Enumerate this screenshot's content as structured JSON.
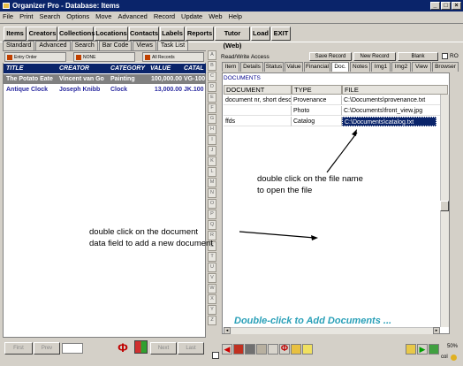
{
  "window": {
    "title": "Organizer Pro - Database: Items"
  },
  "menu": [
    "File",
    "Print",
    "Search",
    "Options",
    "Move",
    "Advanced",
    "Record",
    "Update",
    "Web",
    "Help"
  ],
  "toolbar": {
    "buttons": [
      "Items",
      "Creators",
      "Collections",
      "Locations",
      "Contacts",
      "Labels",
      "Reports",
      "Tutor (Web)",
      "Load",
      "EXIT"
    ]
  },
  "left_tabs": [
    "Standard",
    "Advanced",
    "Search",
    "Bar Code",
    "Views",
    "Task List"
  ],
  "left_tools": {
    "entry_order": "Entry Order",
    "none": "NONE",
    "all_records": "All Records"
  },
  "list": {
    "columns": [
      "TITLE",
      "CREATOR",
      "CATEGORY",
      "VALUE",
      "CATAL"
    ],
    "rows": [
      {
        "title": "The Potato Eate",
        "creator": "Vincent van Go",
        "category": "Painting",
        "value": "100,000.00",
        "catalog": "VG-100"
      },
      {
        "title": "Antique Clock",
        "creator": "Joseph Knibb",
        "category": "Clock",
        "value": "13,000.00",
        "catalog": "JK.100"
      }
    ]
  },
  "alphabet": [
    "A",
    "B",
    "C",
    "D",
    "E",
    "F",
    "G",
    "H",
    "I",
    "J",
    "K",
    "L",
    "M",
    "N",
    "O",
    "P",
    "Q",
    "R",
    "S",
    "T",
    "U",
    "V",
    "W",
    "X",
    "Y",
    "Z"
  ],
  "right_header": {
    "access": "Read/Write Access",
    "save": "Save Record",
    "new": "New Record",
    "blank": "Blank",
    "ro": "RO"
  },
  "right_tabs": [
    "Item",
    "Details",
    "Status",
    "Value",
    "Financial",
    "Doc.",
    "Notes",
    "Img1",
    "Img2",
    "View",
    "Browser"
  ],
  "documents": {
    "section_label": "DOCUMENTS",
    "columns": [
      "DOCUMENT",
      "TYPE",
      "FILE"
    ],
    "rows": [
      {
        "document": "document nr, short desc",
        "type": "Provenance",
        "file": "C:\\Documents\\provenance.txt"
      },
      {
        "document": "",
        "type": "Photo",
        "file": "C:\\Documents\\front_view.jpg"
      },
      {
        "document": "ffds",
        "type": "Catalog",
        "file": "C:\\Documents\\catalog.txt"
      }
    ],
    "hint": "Double-click to Add Documents ..."
  },
  "annotations": {
    "file_line1": "double click on the file name",
    "file_line2": "to open the file",
    "doc_line1": "double click on the document",
    "doc_line2": "data field to add a new document"
  },
  "bottom": {
    "first": "First",
    "prev": "Prev",
    "next": "Next",
    "last": "Last",
    "zoom": "50%",
    "col": "col"
  },
  "colors": {
    "titlebar": "#0a246a",
    "list_header": "#0a246a",
    "row_selected": "#808080",
    "hint_text": "#2aa0b8",
    "link_text": "#00008b"
  }
}
